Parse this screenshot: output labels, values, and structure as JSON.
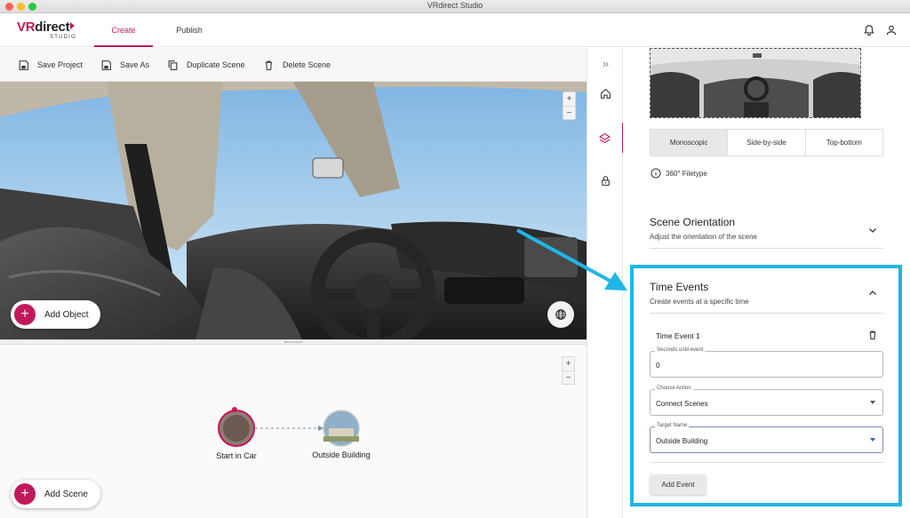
{
  "window": {
    "title": "VRdirect Studio"
  },
  "logo": {
    "brand_vr": "VR",
    "brand_rest": "direct",
    "sub": "STUDIO"
  },
  "nav": {
    "tabs": [
      {
        "label": "Create"
      },
      {
        "label": "Publish"
      }
    ]
  },
  "header_icons": [
    "bell-icon",
    "user-icon"
  ],
  "toolbar": {
    "save_project": "Save Project",
    "save_as": "Save As",
    "duplicate_scene": "Duplicate Scene",
    "delete_scene": "Delete Scene"
  },
  "pano_controls": {
    "zoom_in": "+",
    "zoom_out": "−"
  },
  "graph_controls": {
    "zoom_in": "+",
    "zoom_out": "−"
  },
  "buttons": {
    "add_object": "Add Object",
    "add_scene": "Add Scene",
    "plus": "+"
  },
  "graph": {
    "nodes": [
      {
        "label": "Start in Car"
      },
      {
        "label": "Outside Building"
      }
    ]
  },
  "rail": {
    "collapse": "»",
    "icons": [
      "home-icon",
      "layers-icon",
      "lock-icon"
    ]
  },
  "panel": {
    "projection_options": [
      "Monoscopic",
      "Side-by-side",
      "Top-bottom"
    ],
    "filetype_label": "360° Filetype",
    "scene_orientation": {
      "title": "Scene Orientation",
      "subtitle": "Adjust the orientation of the scene"
    },
    "time_events": {
      "title": "Time Events",
      "subtitle": "Create events at a specific time",
      "event_name": "Time Event 1",
      "seconds_label": "Seconds until event",
      "seconds_value": "0",
      "action_label": "Choose Action",
      "action_value": "Connect Scenes",
      "target_label": "Target Name",
      "target_value": "Outside Building",
      "add_event": "Add Event"
    }
  },
  "colors": {
    "accent": "#c2185b",
    "highlight": "#1fb6e8"
  }
}
